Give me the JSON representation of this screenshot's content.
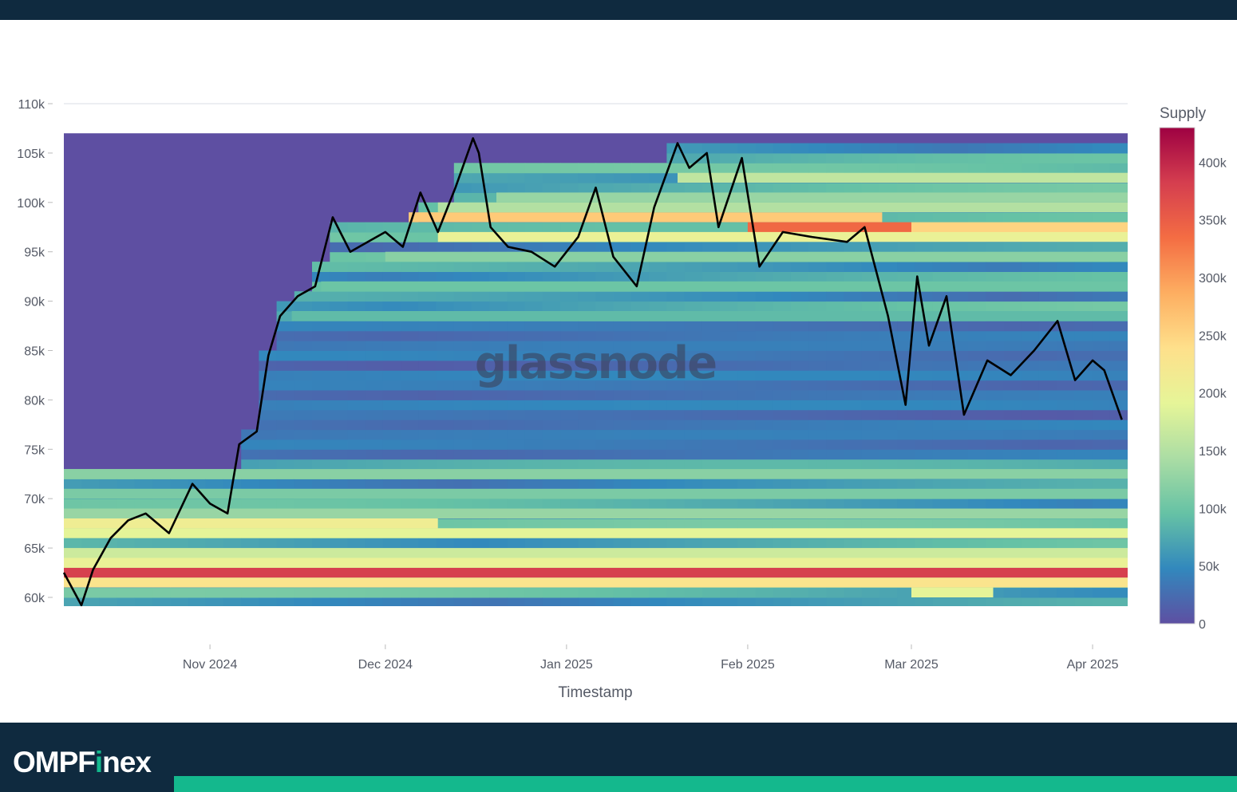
{
  "brand": {
    "prefix": "OMPF",
    "accent": "i",
    "suffix": "nex"
  },
  "colors": {
    "band": "#0f2a3f",
    "accent": "#14b88d",
    "price_line": "#000000",
    "empty_supply": "#5e4fa2"
  },
  "watermark": "glassnode",
  "chart_data": {
    "type": "heatmap",
    "title": "",
    "xlabel": "Timestamp",
    "colorbar_label": "Supply",
    "x_range": [
      "2024-10-07",
      "2025-04-07"
    ],
    "ylim": [
      59000,
      110000
    ],
    "y_ticks": [
      60000,
      65000,
      70000,
      75000,
      80000,
      85000,
      90000,
      95000,
      100000,
      105000,
      110000
    ],
    "y_tick_labels": [
      "60k",
      "65k",
      "70k",
      "75k",
      "80k",
      "85k",
      "90k",
      "95k",
      "100k",
      "105k",
      "110k"
    ],
    "x_ticks": [
      "2024-11-01",
      "2024-12-01",
      "2025-01-01",
      "2025-02-01",
      "2025-03-01",
      "2025-04-01"
    ],
    "x_tick_labels": [
      "Nov 2024",
      "Dec 2024",
      "Jan 2025",
      "Feb 2025",
      "Mar 2025",
      "Apr 2025"
    ],
    "colorbar_range": [
      0,
      430000
    ],
    "colorbar_ticks": [
      0,
      50000,
      100000,
      150000,
      200000,
      250000,
      300000,
      350000,
      400000
    ],
    "colorbar_tick_labels": [
      "0",
      "50k",
      "100k",
      "150k",
      "200k",
      "250k",
      "300k",
      "350k",
      "400k"
    ],
    "colorscale": [
      "#5e4fa2",
      "#3288bd",
      "#66c2a5",
      "#abdda4",
      "#e6f598",
      "#fee08b",
      "#fdae61",
      "#f46d43",
      "#d53e4f",
      "#9e0142"
    ],
    "heatmap_price_range": [
      59000,
      107000
    ],
    "heatmap_bin_size": 1000,
    "supply_bands": [
      {
        "price": 62000,
        "start": "2024-10-07",
        "end": "2025-04-07",
        "supply": 380000
      },
      {
        "price": 61000,
        "start": "2024-10-07",
        "end": "2025-04-07",
        "supply": 230000
      },
      {
        "price": 63000,
        "start": "2024-10-07",
        "end": "2025-04-07",
        "supply": 200000
      },
      {
        "price": 64000,
        "start": "2024-10-07",
        "end": "2025-04-07",
        "supply": 170000
      },
      {
        "price": 66000,
        "start": "2024-10-07",
        "end": "2025-04-07",
        "supply": 190000
      },
      {
        "price": 67000,
        "start": "2024-10-07",
        "end": "2024-12-10",
        "supply": 210000
      },
      {
        "price": 68000,
        "start": "2024-10-07",
        "end": "2025-04-07",
        "supply": 130000
      },
      {
        "price": 70000,
        "start": "2024-10-07",
        "end": "2025-04-07",
        "supply": 110000
      },
      {
        "price": 72000,
        "start": "2024-10-07",
        "end": "2025-04-07",
        "supply": 120000
      },
      {
        "price": 98000,
        "start": "2024-12-05",
        "end": "2025-02-24",
        "supply": 260000
      },
      {
        "price": 97000,
        "start": "2025-02-01",
        "end": "2025-03-01",
        "supply": 340000
      },
      {
        "price": 97000,
        "start": "2025-03-01",
        "end": "2025-04-07",
        "supply": 250000
      },
      {
        "price": 96000,
        "start": "2024-12-10",
        "end": "2025-04-07",
        "supply": 200000
      },
      {
        "price": 99000,
        "start": "2024-12-10",
        "end": "2025-04-07",
        "supply": 150000
      },
      {
        "price": 100000,
        "start": "2024-12-20",
        "end": "2025-04-07",
        "supply": 130000
      },
      {
        "price": 102000,
        "start": "2025-01-20",
        "end": "2025-04-07",
        "supply": 160000
      },
      {
        "price": 94000,
        "start": "2024-12-01",
        "end": "2025-04-07",
        "supply": 120000
      },
      {
        "price": 91000,
        "start": "2024-11-20",
        "end": "2025-04-07",
        "supply": 100000
      },
      {
        "price": 88000,
        "start": "2024-11-15",
        "end": "2025-04-07",
        "supply": 90000
      },
      {
        "price": 60000,
        "start": "2025-03-01",
        "end": "2025-03-15",
        "supply": 190000
      }
    ],
    "series": [
      {
        "type": "line",
        "x": [
          "2024-10-07",
          "2024-10-10",
          "2024-10-12",
          "2024-10-15",
          "2024-10-18",
          "2024-10-21",
          "2024-10-25",
          "2024-10-29",
          "2024-11-01",
          "2024-11-04",
          "2024-11-06",
          "2024-11-09",
          "2024-11-11",
          "2024-11-13",
          "2024-11-16",
          "2024-11-19",
          "2024-11-22",
          "2024-11-25",
          "2024-11-28",
          "2024-12-01",
          "2024-12-04",
          "2024-12-07",
          "2024-12-10",
          "2024-12-13",
          "2024-12-16",
          "2024-12-17",
          "2024-12-19",
          "2024-12-22",
          "2024-12-26",
          "2024-12-30",
          "2025-01-03",
          "2025-01-06",
          "2025-01-09",
          "2025-01-13",
          "2025-01-16",
          "2025-01-20",
          "2025-01-22",
          "2025-01-25",
          "2025-01-27",
          "2025-01-31",
          "2025-02-03",
          "2025-02-07",
          "2025-02-12",
          "2025-02-18",
          "2025-02-21",
          "2025-02-25",
          "2025-02-28",
          "2025-03-02",
          "2025-03-04",
          "2025-03-07",
          "2025-03-10",
          "2025-03-14",
          "2025-03-18",
          "2025-03-22",
          "2025-03-26",
          "2025-03-29",
          "2025-04-01",
          "2025-04-03",
          "2025-04-06"
        ],
        "values": [
          62500,
          59200,
          62800,
          66000,
          67800,
          68500,
          66500,
          71500,
          69500,
          68500,
          75500,
          76800,
          84500,
          88500,
          90500,
          91500,
          98500,
          95000,
          96000,
          97000,
          95500,
          101000,
          97000,
          101500,
          106500,
          105000,
          97500,
          95500,
          95000,
          93500,
          96500,
          101500,
          94500,
          91500,
          99500,
          106000,
          103500,
          105000,
          97500,
          104500,
          93500,
          97000,
          96500,
          96000,
          97500,
          88500,
          79500,
          92500,
          85500,
          90500,
          78500,
          84000,
          82500,
          85000,
          88000,
          82000,
          84000,
          83000,
          78000
        ]
      }
    ]
  }
}
